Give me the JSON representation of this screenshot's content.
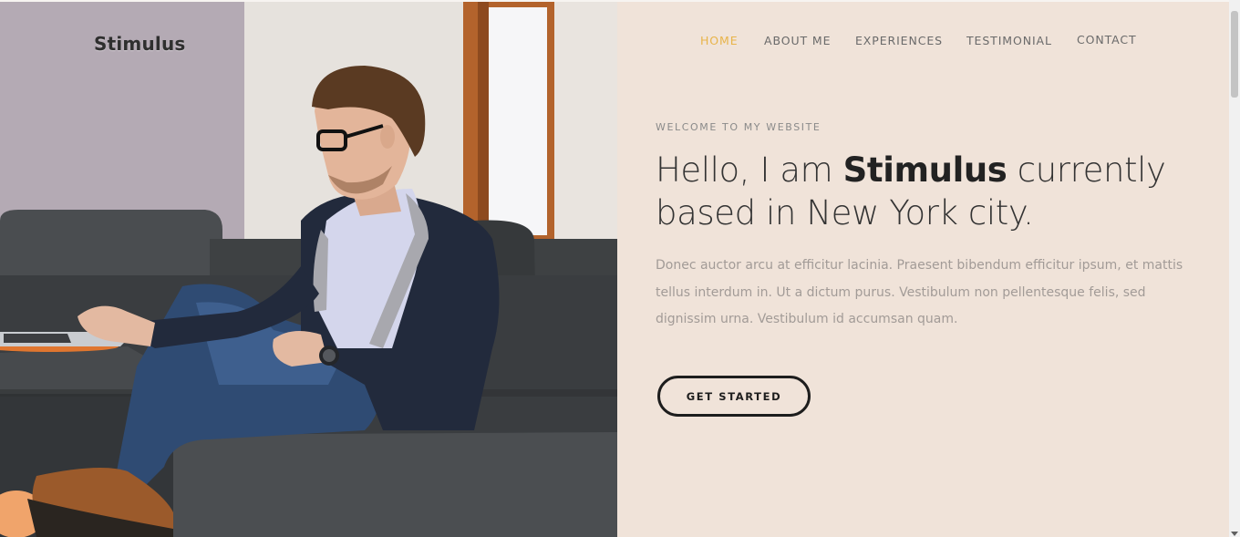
{
  "brand": {
    "logo_text": "Stimulus"
  },
  "nav": {
    "items": [
      {
        "label": "HOME",
        "active": true
      },
      {
        "label": "ABOUT ME",
        "active": false
      },
      {
        "label": "EXPERIENCES",
        "active": false
      },
      {
        "label": "TESTIMONIAL",
        "active": false
      },
      {
        "label": "CONTACT",
        "active": false
      }
    ]
  },
  "hero": {
    "eyebrow": "WELCOME TO MY WEBSITE",
    "headline_pre": "Hello, I am ",
    "headline_name": "Stimulus",
    "headline_post": " currently based in New York city.",
    "paragraph": "Donec auctor arcu at efficitur lacinia. Praesent bibendum efficitur ipsum, et mattis tellus interdum in. Ut a dictum purus. Vestibulum non pellentesque felis, sed dignissim urna. Vestibulum id accumsan quam.",
    "cta_label": "GET STARTED"
  },
  "colors": {
    "background": "#f0e3d9",
    "nav_active": "#e8b44a",
    "nav_text": "#6a6a6a",
    "headline": "#333333",
    "paragraph": "#a29b97",
    "button_border": "#1d1d1d"
  },
  "photo": {
    "subject": "man-with-laptop-on-sofa"
  }
}
